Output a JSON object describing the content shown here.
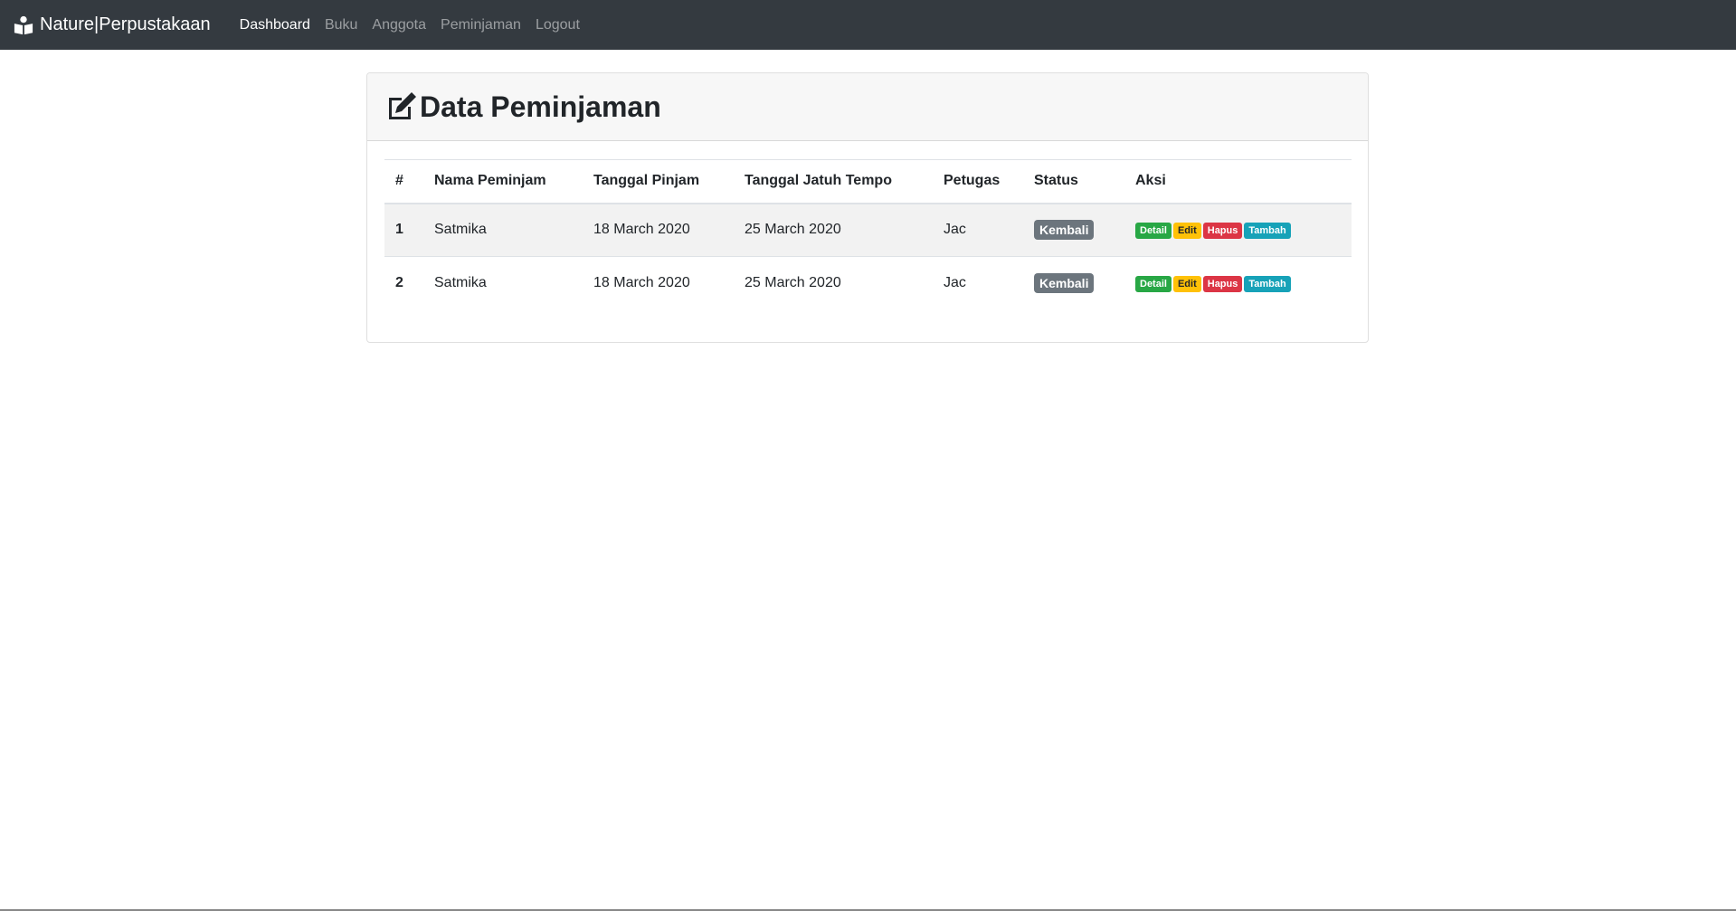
{
  "navbar": {
    "brand": "Nature|Perpustakaan",
    "links": [
      "Dashboard",
      "Buku",
      "Anggota",
      "Peminjaman",
      "Logout"
    ],
    "active_index": 0
  },
  "card": {
    "title": "Data Peminjaman",
    "icon": "edit-icon"
  },
  "table": {
    "headers": [
      "#",
      "Nama Peminjam",
      "Tanggal Pinjam",
      "Tanggal Jatuh Tempo",
      "Petugas",
      "Status",
      "Aksi"
    ],
    "rows": [
      {
        "no": "1",
        "nama": "Satmika",
        "tgl_pinjam": "18 March 2020",
        "tgl_jatuh_tempo": "25 March 2020",
        "petugas": "Jac",
        "status": "Kembali",
        "actions": [
          "Detail",
          "Edit",
          "Hapus",
          "Tambah"
        ]
      },
      {
        "no": "2",
        "nama": "Satmika",
        "tgl_pinjam": "18 March 2020",
        "tgl_jatuh_tempo": "25 March 2020",
        "petugas": "Jac",
        "status": "Kembali",
        "actions": [
          "Detail",
          "Edit",
          "Hapus",
          "Tambah"
        ]
      }
    ]
  },
  "colors": {
    "navbar_bg": "#343a40",
    "detail": "#28a745",
    "edit": "#ffc107",
    "hapus": "#dc3545",
    "tambah": "#17a2b8",
    "status": "#6c757d"
  }
}
